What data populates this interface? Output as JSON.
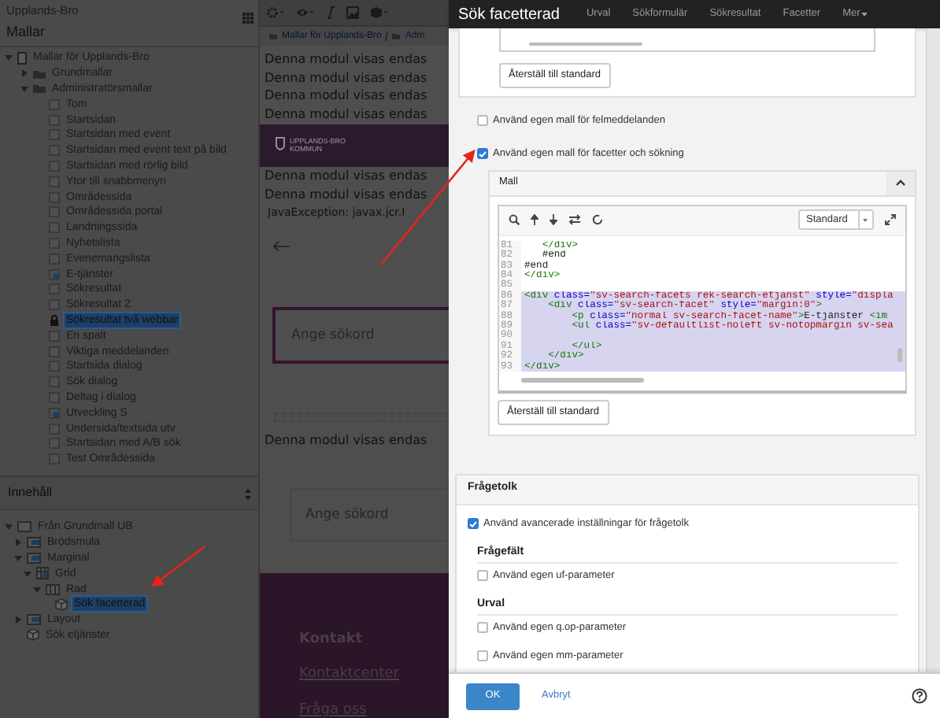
{
  "sidebar": {
    "site": "Upplands-Bro",
    "title": "Mallar",
    "template_tree": [
      {
        "label": "Mallar för Upplands-Bro",
        "kind": "site",
        "expanded": true,
        "selected": false,
        "children": [
          {
            "label": "Grundmallar",
            "kind": "folder",
            "expanded": false,
            "selected": false
          },
          {
            "label": "Administratörsmallar",
            "kind": "folder",
            "expanded": true,
            "selected": false,
            "children": [
              {
                "label": "Tom",
                "kind": "template",
                "selected": false
              },
              {
                "label": "Startsidan",
                "kind": "template",
                "selected": false
              },
              {
                "label": "Startsidan med event",
                "kind": "template",
                "selected": false
              },
              {
                "label": "Startsidan med event text på bild",
                "kind": "template",
                "selected": false
              },
              {
                "label": "Startsidan med rörlig bild",
                "kind": "template",
                "selected": false
              },
              {
                "label": "Ytor till snabbmenyn",
                "kind": "template",
                "selected": false
              },
              {
                "label": "Områdessida",
                "kind": "template",
                "selected": false
              },
              {
                "label": "Områdessida portal",
                "kind": "template",
                "selected": false
              },
              {
                "label": "Landningssida",
                "kind": "template",
                "selected": false
              },
              {
                "label": "Nyhetslista",
                "kind": "template",
                "selected": false
              },
              {
                "label": "Evenemangslista",
                "kind": "template",
                "selected": false
              },
              {
                "label": "E-tjänster",
                "kind": "shared",
                "selected": false
              },
              {
                "label": "Sökresultat",
                "kind": "template",
                "selected": false
              },
              {
                "label": "Sökresultat 2",
                "kind": "template",
                "selected": false
              },
              {
                "label": "Sökresultat två webbar",
                "kind": "locked",
                "selected": true
              },
              {
                "label": "En spalt",
                "kind": "template",
                "selected": false
              },
              {
                "label": "Viktiga meddelanden",
                "kind": "template",
                "selected": false
              },
              {
                "label": "Startsida dialog",
                "kind": "template",
                "selected": false
              },
              {
                "label": "Sök dialog",
                "kind": "template",
                "selected": false
              },
              {
                "label": "Deltag i dialog",
                "kind": "template",
                "selected": false
              },
              {
                "label": "Utveckling S",
                "kind": "shared",
                "selected": false
              },
              {
                "label": "Undersida/textsida utv",
                "kind": "template",
                "selected": false
              },
              {
                "label": "Startsidan med A/B sök",
                "kind": "template",
                "selected": false
              },
              {
                "label": "Test Områdessida",
                "kind": "template",
                "selected": false
              }
            ]
          }
        ]
      }
    ],
    "content_title": "Innehåll",
    "content_tree": [
      {
        "label": "Från Grundmall UB",
        "kind": "page",
        "expanded": true,
        "selected": false,
        "children": [
          {
            "label": "Brödsmula",
            "kind": "layout",
            "expanded": false,
            "selected": false
          },
          {
            "label": "Marginal",
            "kind": "layout",
            "expanded": true,
            "selected": false,
            "children": [
              {
                "label": "Grid",
                "kind": "grid",
                "expanded": true,
                "selected": false,
                "children": [
                  {
                    "label": "Rad",
                    "kind": "row",
                    "expanded": true,
                    "selected": false,
                    "children": [
                      {
                        "label": "Sök facetterad",
                        "kind": "module",
                        "selected": true
                      }
                    ]
                  }
                ]
              }
            ]
          },
          {
            "label": "Layout",
            "kind": "layout",
            "expanded": false,
            "selected": false
          },
          {
            "label": "Sök etjänster",
            "kind": "module",
            "selected": false
          }
        ]
      }
    ]
  },
  "preview": {
    "breadcrumb": [
      "Mallar för Upplands-Bro",
      "Adm"
    ],
    "blocks": [
      {
        "kind": "notice",
        "text": "Denna modul visas endas"
      },
      {
        "kind": "notice",
        "text": "Denna modul visas endas"
      },
      {
        "kind": "notice",
        "text": "Denna modul visas endas"
      },
      {
        "kind": "notice",
        "text": "Denna modul visas endas"
      },
      {
        "kind": "banner",
        "logo": [
          "UPPLANDS-BRO",
          "KOMMUN"
        ]
      },
      {
        "kind": "notice",
        "text": "Denna modul visas endas"
      },
      {
        "kind": "notice",
        "text": "Denna modul visas endas"
      },
      {
        "kind": "error",
        "text": "JavaException: javax.jcr.I"
      },
      {
        "kind": "back"
      },
      {
        "kind": "search",
        "placeholder": "Ange sökord",
        "focused": true
      },
      {
        "kind": "divider"
      },
      {
        "kind": "notice",
        "text": "Denna modul visas endas"
      },
      {
        "kind": "search",
        "placeholder": "Ange sökord",
        "focused": false
      },
      {
        "kind": "footer",
        "heading": "Kontakt",
        "links": [
          "Kontaktcenter",
          "Fråga oss"
        ]
      }
    ]
  },
  "dialog": {
    "title": "Sök facetterad",
    "tabs": [
      {
        "label": "Urval",
        "kind": "link",
        "selected": false
      },
      {
        "label": "Sökformulär",
        "kind": "link",
        "selected": false
      },
      {
        "label": "Sökresultat",
        "kind": "link",
        "selected": false
      },
      {
        "label": "Facetter",
        "kind": "link",
        "selected": false
      },
      {
        "label": "Mer",
        "kind": "dropdown",
        "selected": false
      }
    ],
    "top_reset_button": "Återställ till standard",
    "options": [
      {
        "label": "Använd egen mall för felmeddelanden",
        "checked": false
      },
      {
        "label": "Använd egen mall för facetter och sökning",
        "checked": true
      }
    ],
    "template_panel": {
      "title": "Mall",
      "expanded": true,
      "mode": "Standard",
      "lines": [
        {
          "number": "81",
          "selected": false,
          "tokens": [
            {
              "kind": "tag",
              "text": "   </div>"
            }
          ]
        },
        {
          "number": "82",
          "selected": false,
          "tokens": [
            {
              "kind": "text",
              "text": "   #end"
            }
          ]
        },
        {
          "number": "83",
          "selected": false,
          "tokens": [
            {
              "kind": "text",
              "text": "#end"
            }
          ]
        },
        {
          "number": "84",
          "selected": false,
          "tokens": [
            {
              "kind": "tag",
              "text": "</div>"
            }
          ]
        },
        {
          "number": "85",
          "selected": false
        },
        {
          "number": "86",
          "selected": true,
          "tokens": [
            {
              "kind": "tag",
              "text": "<div"
            },
            {
              "kind": "attr",
              "text": " class="
            },
            {
              "kind": "string",
              "text": "\"sv-search-facets rek-search-etjanst\""
            },
            {
              "kind": "attr",
              "text": " style="
            },
            {
              "kind": "string",
              "text": "\"displa"
            }
          ]
        },
        {
          "number": "87",
          "selected": true,
          "tokens": [
            {
              "kind": "tag",
              "text": "    <div"
            },
            {
              "kind": "attr",
              "text": " class="
            },
            {
              "kind": "string",
              "text": "\"sv-search-facet\""
            },
            {
              "kind": "attr",
              "text": " style="
            },
            {
              "kind": "string",
              "text": "\"margin:0\""
            },
            {
              "kind": "tag",
              "text": ">"
            }
          ]
        },
        {
          "number": "88",
          "selected": true,
          "tokens": [
            {
              "kind": "tag",
              "text": "        <p"
            },
            {
              "kind": "attr",
              "text": " class="
            },
            {
              "kind": "string",
              "text": "\"normal sv-search-facet-name\""
            },
            {
              "kind": "tag",
              "text": ">"
            },
            {
              "kind": "text",
              "text": "E-tjänster "
            },
            {
              "kind": "tag",
              "text": "<im"
            }
          ]
        },
        {
          "number": "89",
          "selected": true,
          "tokens": [
            {
              "kind": "tag",
              "text": "        <ul"
            },
            {
              "kind": "attr",
              "text": " class="
            },
            {
              "kind": "string",
              "text": "\"sv-defaultlist-noleft sv-notopmargin sv-sea"
            }
          ]
        },
        {
          "number": "90",
          "selected": true
        },
        {
          "number": "91",
          "selected": true,
          "tokens": [
            {
              "kind": "tag",
              "text": "        </ul>"
            }
          ]
        },
        {
          "number": "92",
          "selected": true,
          "tokens": [
            {
              "kind": "tag",
              "text": "    </div>"
            }
          ]
        },
        {
          "number": "93",
          "selected": true,
          "tokens": [
            {
              "kind": "tag",
              "text": "</div>"
            }
          ]
        }
      ],
      "reset_button": "Återställ till standard"
    },
    "query_panel": {
      "title": "Frågetolk",
      "option": {
        "label": "Använd avancerade inställningar för frågetolk",
        "checked": true
      },
      "sections": [
        {
          "title": "Frågefält",
          "options": [
            {
              "label": "Använd egen uf-parameter",
              "checked": false
            }
          ]
        },
        {
          "title": "Urval",
          "options": [
            {
              "label": "Använd egen q.op-parameter",
              "checked": false
            },
            {
              "label": "Använd egen mm-parameter",
              "checked": false
            }
          ]
        }
      ]
    },
    "ok_button": "OK",
    "cancel_link": "Avbryt"
  }
}
